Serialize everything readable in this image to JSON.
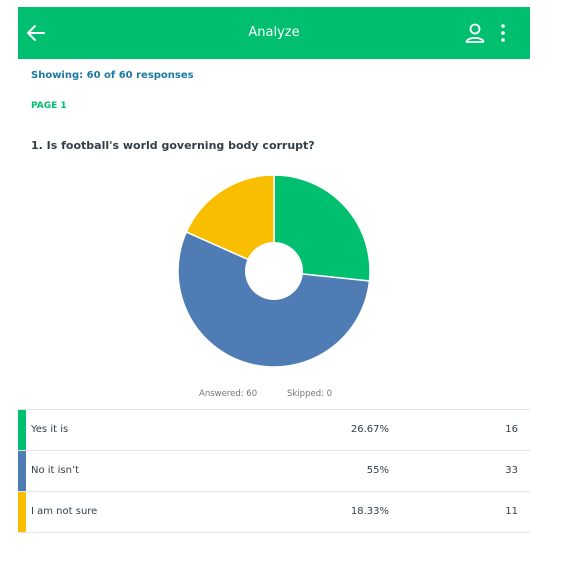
{
  "header": {
    "title": "Analyze",
    "back_icon": "arrow-left-icon",
    "user_icon": "user-icon",
    "more_icon": "more-vertical-icon",
    "background": "#00bf6f"
  },
  "summary": {
    "showing": "Showing: 60 of 60 responses",
    "page": "PAGE 1"
  },
  "question": {
    "title": "1. Is football's world governing body corrupt?",
    "answered": "Answered: 60",
    "skipped": "Skipped: 0"
  },
  "chart_data": {
    "type": "pie",
    "donut": true,
    "labels": [
      "Yes it is",
      "No it isn't",
      "I am not sure"
    ],
    "values": [
      26.67,
      55,
      18.33
    ],
    "colors": [
      "#00bf6f",
      "#507cb6",
      "#f9be00"
    ]
  },
  "table": {
    "rows": [
      {
        "label": "Yes it is",
        "percent": "26.67%",
        "count": "16",
        "color": "#00bf6f"
      },
      {
        "label": "No it isn’t",
        "percent": "55%",
        "count": "33",
        "color": "#507cb6"
      },
      {
        "label": "I am not sure",
        "percent": "18.33%",
        "count": "11",
        "color": "#f9be00"
      }
    ]
  }
}
